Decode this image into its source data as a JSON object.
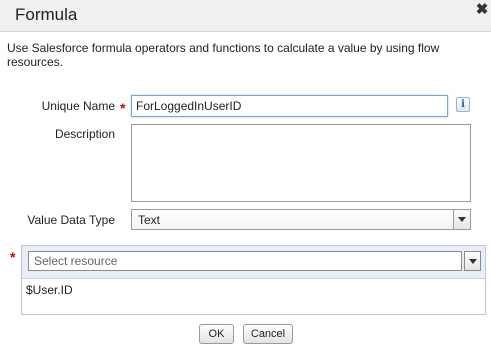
{
  "dialog": {
    "title": "Formula",
    "close_icon": "close-icon",
    "intro": "Use Salesforce formula operators and functions to calculate a value by using flow resources."
  },
  "form": {
    "unique_name": {
      "label": "Unique Name",
      "required_mark": "*",
      "value": "ForLoggedInUserID",
      "info_icon": "info-icon"
    },
    "description": {
      "label": "Description",
      "value": ""
    },
    "value_data_type": {
      "label": "Value Data Type",
      "selected": "Text"
    }
  },
  "formula": {
    "required_mark": "*",
    "resource_placeholder": "Select resource",
    "expression": "$User.ID"
  },
  "buttons": {
    "ok": "OK",
    "cancel": "Cancel"
  }
}
